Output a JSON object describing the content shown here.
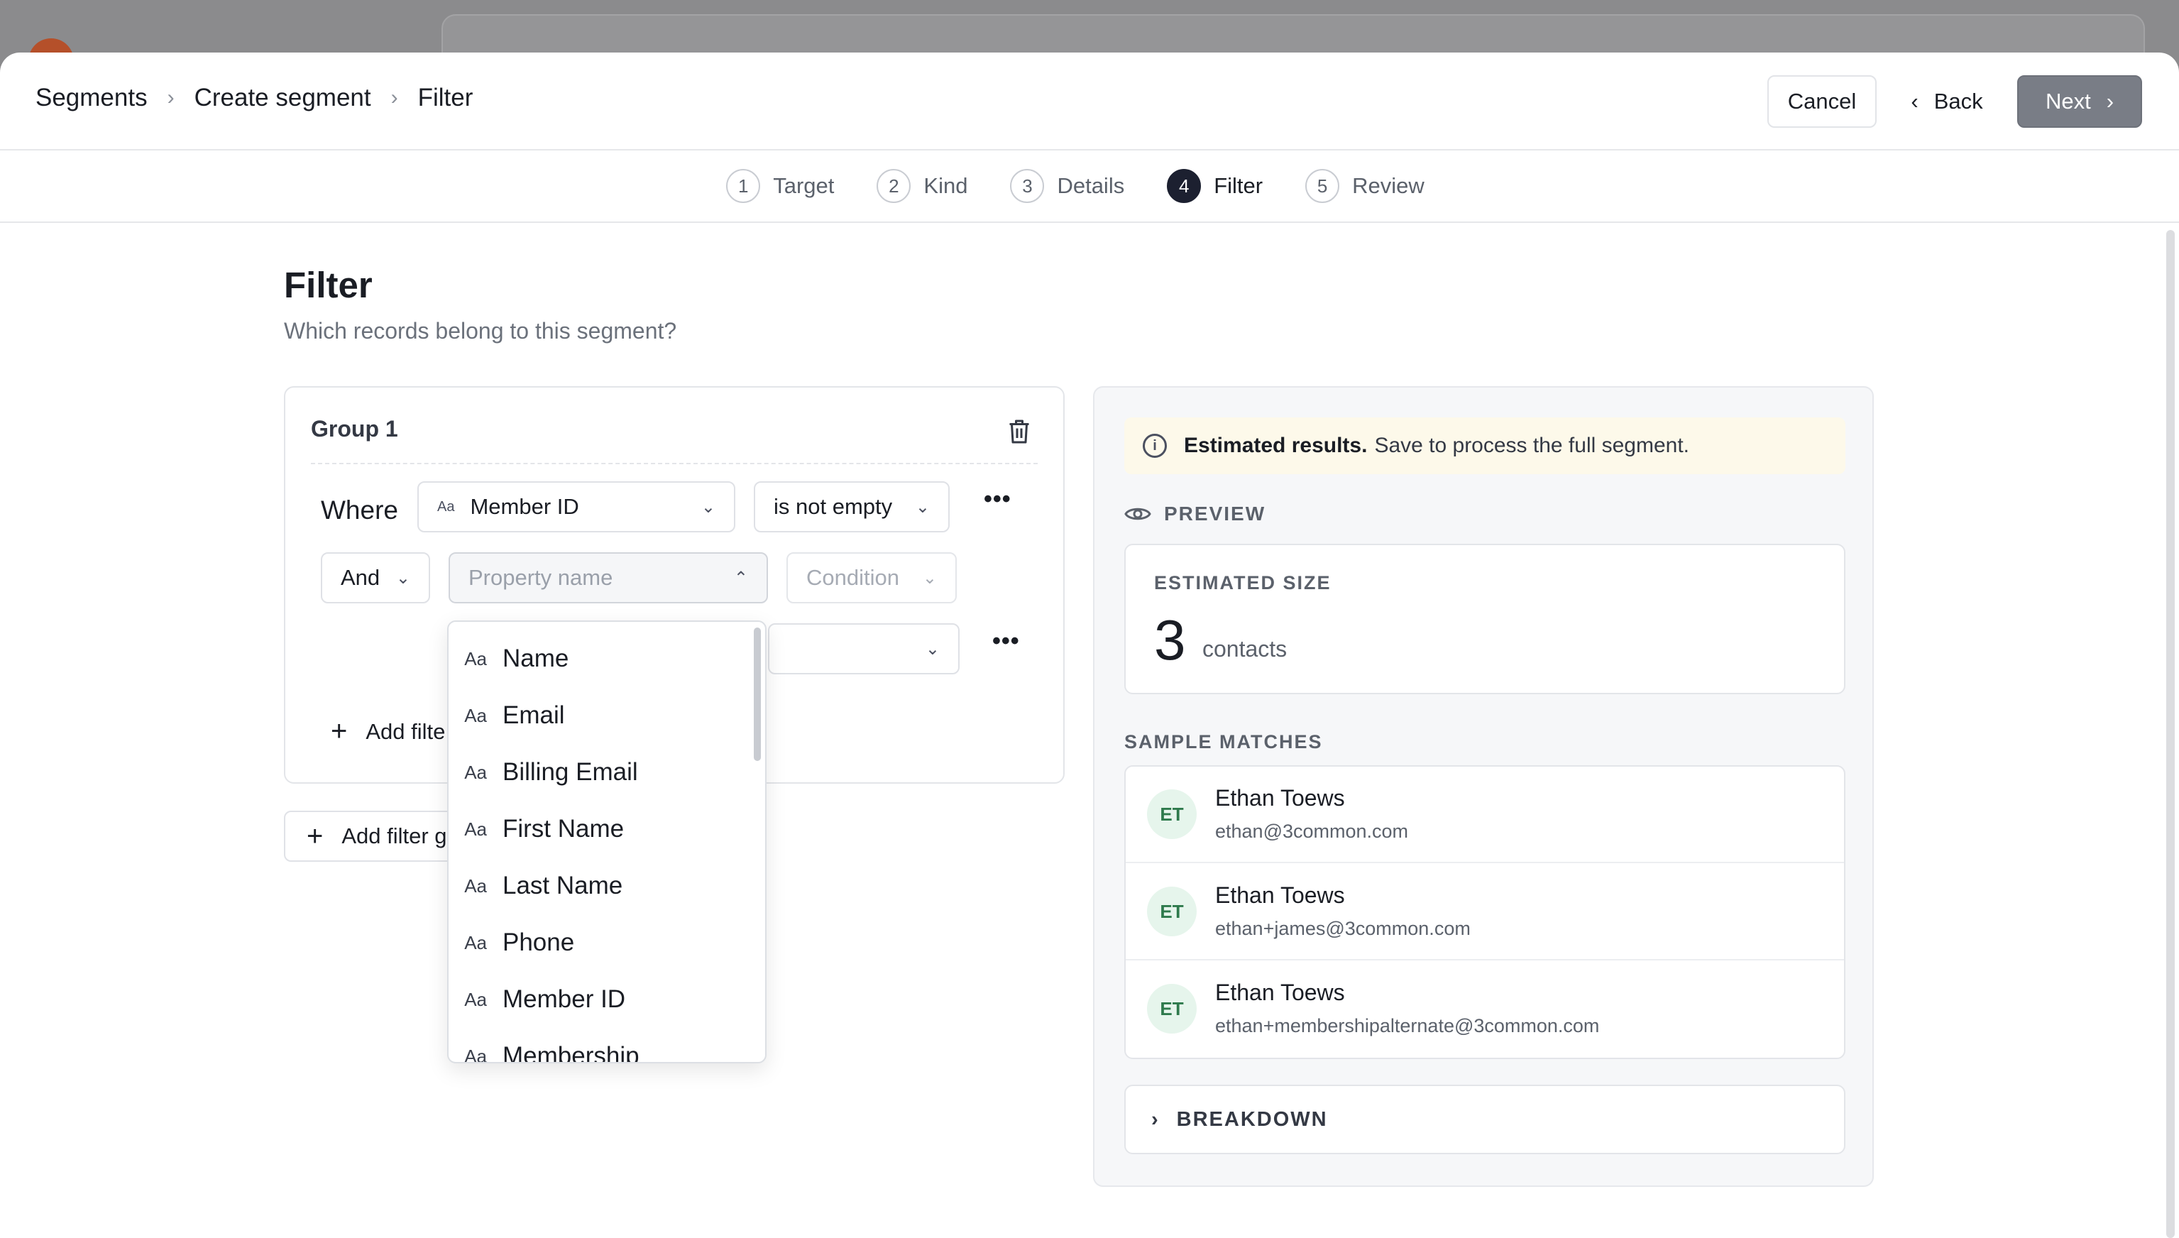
{
  "breadcrumb": [
    "Segments",
    "Create segment",
    "Filter"
  ],
  "actions": {
    "cancel": "Cancel",
    "back": "Back",
    "next": "Next"
  },
  "steps": [
    {
      "num": "1",
      "label": "Target"
    },
    {
      "num": "2",
      "label": "Kind"
    },
    {
      "num": "3",
      "label": "Details"
    },
    {
      "num": "4",
      "label": "Filter",
      "active": true
    },
    {
      "num": "5",
      "label": "Review"
    }
  ],
  "page": {
    "title": "Filter",
    "subtitle": "Which records belong to this segment?"
  },
  "group": {
    "title": "Group 1",
    "rule1": {
      "connector": "Where",
      "property": "Member ID",
      "operator": "is not empty"
    },
    "rule2": {
      "connector": "And",
      "property_placeholder": "Property name",
      "condition_placeholder": "Condition"
    },
    "add_filter": "Add filte",
    "add_group": "Add filter g"
  },
  "dropdown": {
    "items": [
      "Name",
      "Email",
      "Billing Email",
      "First Name",
      "Last Name",
      "Phone",
      "Member ID",
      "Membership"
    ],
    "icon_label": "Aa"
  },
  "preview": {
    "notice_bold": "Estimated results.",
    "notice_text": "Save to process the full segment.",
    "label": "PREVIEW",
    "size_label": "ESTIMATED SIZE",
    "size_value": "3",
    "size_unit": "contacts",
    "sample_label": "SAMPLE MATCHES",
    "matches": [
      {
        "initials": "ET",
        "name": "Ethan Toews",
        "email": "ethan@3common.com"
      },
      {
        "initials": "ET",
        "name": "Ethan Toews",
        "email": "ethan+james@3common.com"
      },
      {
        "initials": "ET",
        "name": "Ethan Toews",
        "email": "ethan+membershipalternate@3common.com"
      }
    ],
    "breakdown": "BREAKDOWN"
  },
  "colors": {
    "active_step": "#1c2030",
    "next_button": "#797d86",
    "notice_bg": "#fdf9ea",
    "avatar_bg": "#e6f5ec",
    "avatar_text": "#2e7a4c"
  }
}
